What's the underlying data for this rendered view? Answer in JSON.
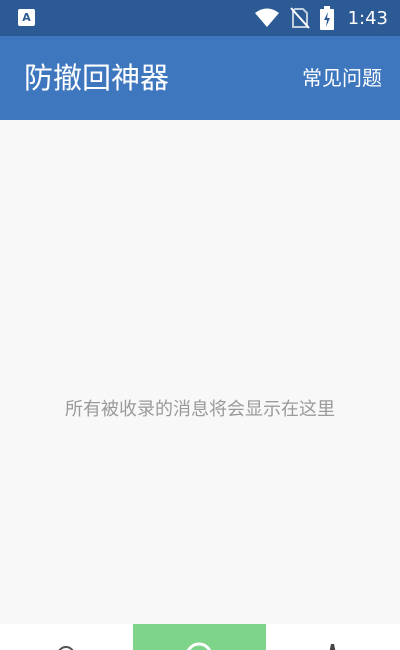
{
  "status_bar": {
    "app_icon_letter": "A",
    "time": "1:43",
    "icons": [
      "notification-app-icon",
      "wifi-icon",
      "no-sim-icon",
      "battery-charging-icon"
    ]
  },
  "app_bar": {
    "title": "防撤回神器",
    "faq_label": "常见问题"
  },
  "content": {
    "empty_message": "所有被收录的消息将会显示在这里"
  },
  "bottom_nav": {
    "items": [
      {
        "icon": "search-icon",
        "selected": false
      },
      {
        "icon": "chat-icon",
        "selected": true
      },
      {
        "icon": "person-icon",
        "selected": false
      }
    ]
  },
  "colors": {
    "status_bar": "#2c5a94",
    "app_bar": "#3f77bf",
    "background": "#f8f8f8",
    "selected_tab": "#7ed58a",
    "empty_text": "#9a9a9a"
  }
}
